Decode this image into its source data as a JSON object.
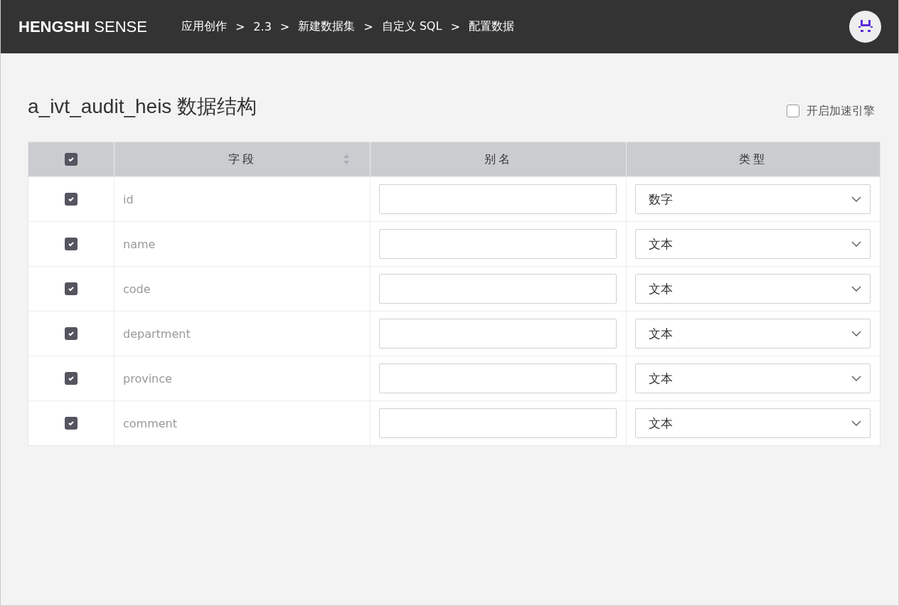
{
  "header": {
    "logo": "**HENGSHI** SENSE",
    "breadcrumb": [
      {
        "label": "应用创作"
      },
      {
        "label": "2.3"
      },
      {
        "label": "新建数据集"
      },
      {
        "label": "自定义 SQL"
      },
      {
        "label": "配置数据"
      }
    ],
    "separator": ">"
  },
  "page": {
    "title": "a_ivt_audit_heis 数据结构",
    "accelerate": {
      "label": "开启加速引擎",
      "checked": false
    }
  },
  "table": {
    "all_checked": true,
    "columns": [
      "字段",
      "别名",
      "类型"
    ],
    "rows": [
      {
        "checked": true,
        "field": "id",
        "type": "数字"
      },
      {
        "checked": true,
        "field": "name",
        "type": "文本"
      },
      {
        "checked": true,
        "field": "code",
        "type": "文本"
      },
      {
        "checked": true,
        "field": "department",
        "type": "文本"
      },
      {
        "checked": true,
        "field": "province",
        "type": "文本"
      },
      {
        "checked": true,
        "field": "comment",
        "type": "文本"
      }
    ]
  }
}
